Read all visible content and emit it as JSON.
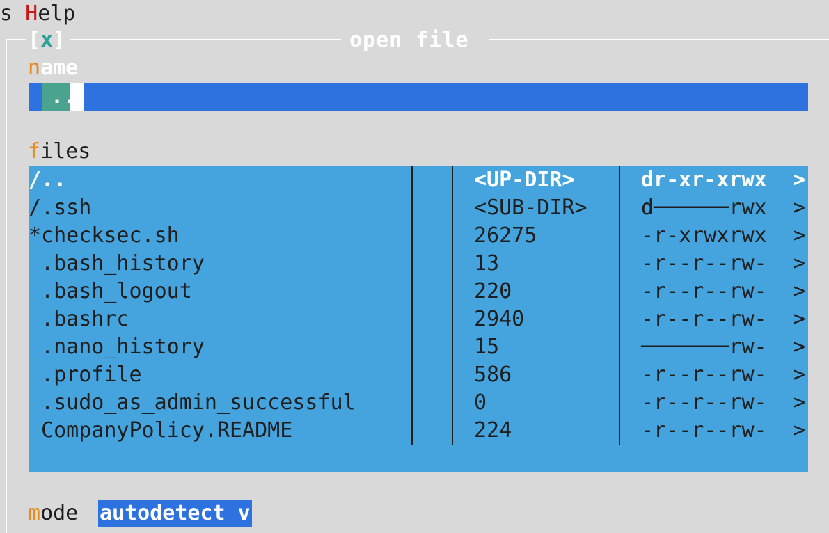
{
  "menubar": {
    "prefix": "s ",
    "help_hotkey": "H",
    "help_rest": "elp"
  },
  "dialog": {
    "close": {
      "open": "[",
      "x": "x",
      "close": "]"
    },
    "title": "open file"
  },
  "name_field": {
    "hotkey": "n",
    "label_rest": "ame",
    "value": ".."
  },
  "files_field": {
    "hotkey": "f",
    "label_rest": "iles"
  },
  "file_list": {
    "rows": [
      {
        "name": "/..",
        "size": "<UP-DIR>",
        "perms": "dr-xr-xrwx",
        "more": ">",
        "selected": true
      },
      {
        "name": "/.ssh",
        "size": "<SUB-DIR>",
        "perms": "d──────rwx",
        "more": ">"
      },
      {
        "name": "*checksec.sh",
        "size": "26275",
        "perms": "-r-xrwxrwx",
        "more": ">"
      },
      {
        "name": " .bash_history",
        "size": "13",
        "perms": "-r--r--rw-",
        "more": ">"
      },
      {
        "name": " .bash_logout",
        "size": "220",
        "perms": "-r--r--rw-",
        "more": ">"
      },
      {
        "name": " .bashrc",
        "size": "2940",
        "perms": "-r--r--rw-",
        "more": ">"
      },
      {
        "name": " .nano_history",
        "size": "15",
        "perms": "───────rw-",
        "more": ">"
      },
      {
        "name": " .profile",
        "size": "586",
        "perms": "-r--r--rw-",
        "more": ">"
      },
      {
        "name": " .sudo_as_admin_successful",
        "size": "0",
        "perms": "-r--r--rw-",
        "more": ">"
      },
      {
        "name": " CompanyPolicy.README",
        "size": "224",
        "perms": "-r--r--rw-",
        "more": ">"
      }
    ]
  },
  "mode_field": {
    "hotkey": "m",
    "label_rest": "ode ",
    "value": "autodetect v"
  }
}
